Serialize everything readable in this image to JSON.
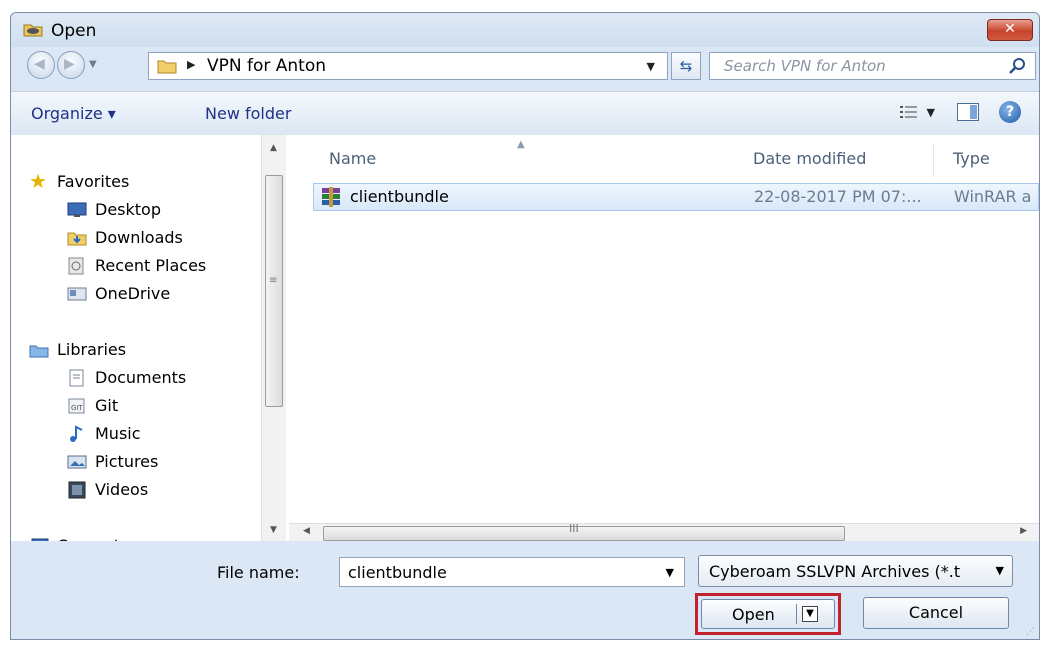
{
  "window": {
    "title": "Open",
    "close_label": "✕"
  },
  "address": {
    "breadcrumb": "VPN for Anton",
    "search_placeholder": "Search VPN for Anton"
  },
  "toolbar": {
    "organize": "Organize ▾",
    "new_folder": "New folder"
  },
  "nav": {
    "favorites": {
      "label": "Favorites",
      "items": [
        "Desktop",
        "Downloads",
        "Recent Places",
        "OneDrive"
      ]
    },
    "libraries": {
      "label": "Libraries",
      "items": [
        "Documents",
        "Git",
        "Music",
        "Pictures",
        "Videos"
      ]
    },
    "computer": {
      "label": "Computer"
    }
  },
  "columns": {
    "name": "Name",
    "date": "Date modified",
    "type": "Type"
  },
  "files": [
    {
      "name": "clientbundle",
      "date": "22-08-2017 PM 07:...",
      "type": "WinRAR a"
    }
  ],
  "bottom": {
    "file_name_label": "File name:",
    "file_name_value": "clientbundle",
    "filter_value": "Cyberoam SSLVPN Archives (*.t",
    "open_label": "Open",
    "cancel_label": "Cancel"
  },
  "colors": {
    "highlight_border": "#c0232c",
    "selection_bg": "#d8e8f9",
    "toolbar_text": "#1e3287"
  }
}
